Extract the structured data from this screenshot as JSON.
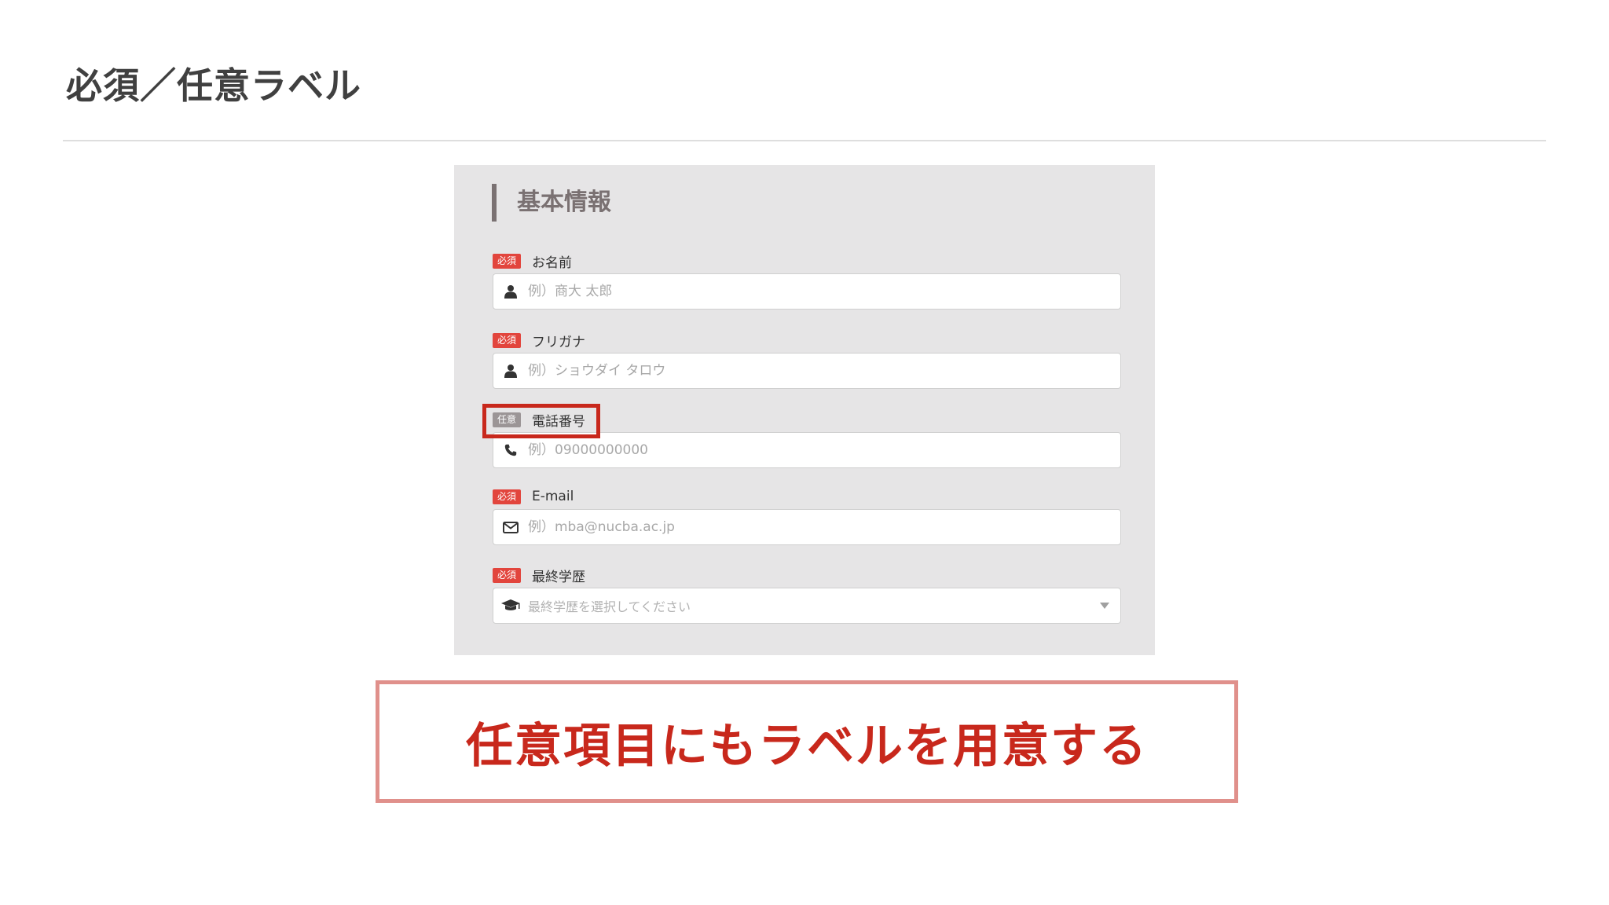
{
  "slide": {
    "title": "必須／任意ラベル",
    "callout": "任意項目にもラベルを用意する"
  },
  "form": {
    "section_title": "基本情報",
    "fields": [
      {
        "badge": "必須",
        "badge_type": "required",
        "label": "お名前",
        "placeholder": "例）商大 太郎",
        "icon": "user-icon"
      },
      {
        "badge": "必須",
        "badge_type": "required",
        "label": "フリガナ",
        "placeholder": "例）ショウダイ タロウ",
        "icon": "user-icon"
      },
      {
        "badge": "任意",
        "badge_type": "optional",
        "label": "電話番号",
        "placeholder": "例）09000000000",
        "icon": "phone-icon"
      },
      {
        "badge": "必須",
        "badge_type": "required",
        "label": "E-mail",
        "placeholder": "例）mba@nucba.ac.jp",
        "icon": "envelope-icon"
      },
      {
        "badge": "必須",
        "badge_type": "required",
        "label": "最終学歴",
        "placeholder": "最終学歴を選択してください",
        "icon": "graduation-cap-icon"
      }
    ]
  },
  "colors": {
    "required_badge": "#e2453d",
    "optional_badge": "#9b9596",
    "highlight": "#c8281c",
    "callout_border": "#e0908b",
    "panel_background": "#e6e5e6"
  }
}
